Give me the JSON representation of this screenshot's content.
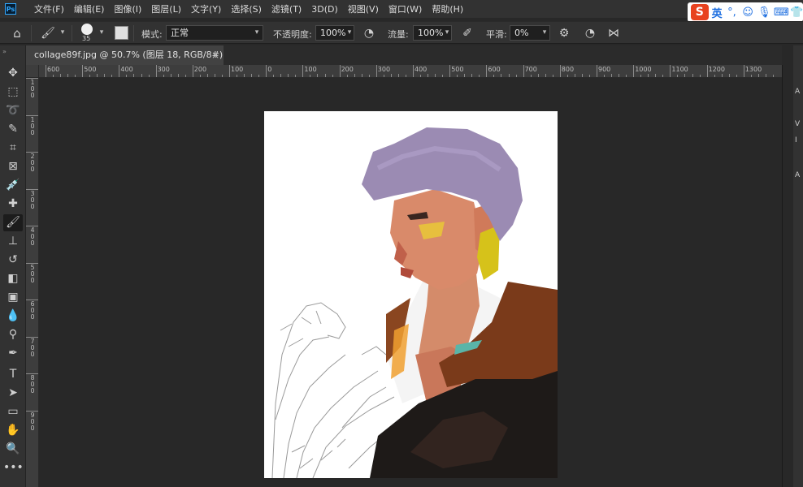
{
  "app": {
    "logo": "Ps",
    "menu": [
      "文件(F)",
      "编辑(E)",
      "图像(I)",
      "图层(L)",
      "文字(Y)",
      "选择(S)",
      "滤镜(T)",
      "3D(D)",
      "视图(V)",
      "窗口(W)",
      "帮助(H)"
    ]
  },
  "ime": {
    "logo": "S",
    "lang": "英",
    "icons": [
      "punctuation-icon",
      "emoji-icon",
      "microphone-icon",
      "keyboard-icon",
      "shirt-icon"
    ]
  },
  "options": {
    "brush_size": "35",
    "mode_label": "模式:",
    "mode_value": "正常",
    "opacity_label": "不透明度:",
    "opacity_value": "100%",
    "flow_label": "流量:",
    "flow_value": "100%",
    "smoothing_label": "平滑:",
    "smoothing_value": "0%"
  },
  "document": {
    "tab_title": "collage89f.jpg @ 50.7% (图层 18, RGB/8#) *",
    "close": "×"
  },
  "ruler": {
    "h_labels": [
      "600",
      "500",
      "400",
      "300",
      "200",
      "100",
      "0",
      "100",
      "200",
      "300",
      "400",
      "500",
      "600",
      "700",
      "800",
      "900",
      "1000",
      "1100",
      "1200",
      "1300"
    ],
    "v_labels": [
      "1",
      "0",
      "0",
      "1",
      "0",
      "0",
      "2",
      "0",
      "0",
      "3",
      "0",
      "0",
      "4",
      "0",
      "0",
      "5",
      "0",
      "0",
      "6",
      "0",
      "0",
      "7",
      "0",
      "0",
      "8",
      "0",
      "0",
      "9",
      "0",
      "0"
    ]
  },
  "right_panel": {
    "items": [
      "A",
      "V",
      "I",
      "A"
    ]
  },
  "colors": {
    "accent": "#31a8ff",
    "hair": "#9b8bb3",
    "jacket_brown": "#7a3a1a",
    "fur_black": "#1e1a18",
    "earring_gold": "#d6c21a",
    "skin": "#d98a6a"
  }
}
